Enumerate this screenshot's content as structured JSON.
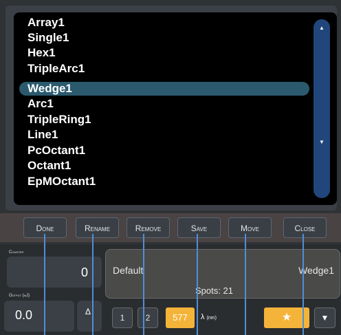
{
  "list": {
    "items": [
      {
        "label": "Array1",
        "selected": false
      },
      {
        "label": "Single1",
        "selected": false
      },
      {
        "label": "Hex1",
        "selected": false
      },
      {
        "label": "TripleArc1",
        "selected": false
      },
      {
        "label": "Wedge1",
        "selected": true
      },
      {
        "label": "Arc1",
        "selected": false
      },
      {
        "label": "TripleRing1",
        "selected": false
      },
      {
        "label": "Line1",
        "selected": false
      },
      {
        "label": "PcOctant1",
        "selected": false
      },
      {
        "label": "Octant1",
        "selected": false
      },
      {
        "label": "EpMOctant1",
        "selected": false
      }
    ],
    "scroll_up_icon": "caret-up-icon",
    "scroll_down_icon": "caret-down-icon"
  },
  "toolbar": {
    "done": "Done",
    "rename": "Rename",
    "remove": "Remove",
    "save": "Save",
    "move": "Move",
    "close": "Close"
  },
  "counter": {
    "label": "Counter",
    "value": "0"
  },
  "output": {
    "label": "Output (mJ)",
    "value": "0.0",
    "delta_symbol": "Δ"
  },
  "info": {
    "left": "Default",
    "right": "Wedge1",
    "spots": "Spots: 21"
  },
  "bottom": {
    "page1": "1",
    "page2": "2",
    "wavelength": "577",
    "lambda": "λ",
    "unit": "(nm)",
    "star_icon": "star-icon",
    "down_icon": "caret-down-icon"
  },
  "colors": {
    "selection": "#2b5a6e",
    "scrollbar": "#21467c",
    "accent": "#f4b43a",
    "guide_line": "#4f8fd8"
  }
}
